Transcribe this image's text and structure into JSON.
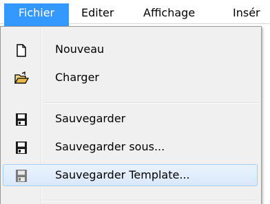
{
  "menubar": {
    "items": [
      {
        "label": "Fichier"
      },
      {
        "label": "Editer"
      },
      {
        "label": "Affichage"
      },
      {
        "label": "Insér"
      }
    ]
  },
  "file_menu": {
    "items": [
      {
        "label": "Nouveau",
        "icon": "new-document-icon"
      },
      {
        "label": "Charger",
        "icon": "open-folder-icon"
      },
      {
        "label": "Sauvegarder",
        "icon": "save-floppy-icon"
      },
      {
        "label": "Sauvegarder sous...",
        "icon": "save-as-floppy-icon"
      },
      {
        "label": "Sauvegarder Template...",
        "icon": "save-template-floppy-icon"
      }
    ],
    "highlighted": "Sauvegarder Template..."
  },
  "colors": {
    "active_menu": "#3399ff",
    "menu_bg": "#f0f0f0",
    "hover_border": "#a8cbf1"
  }
}
